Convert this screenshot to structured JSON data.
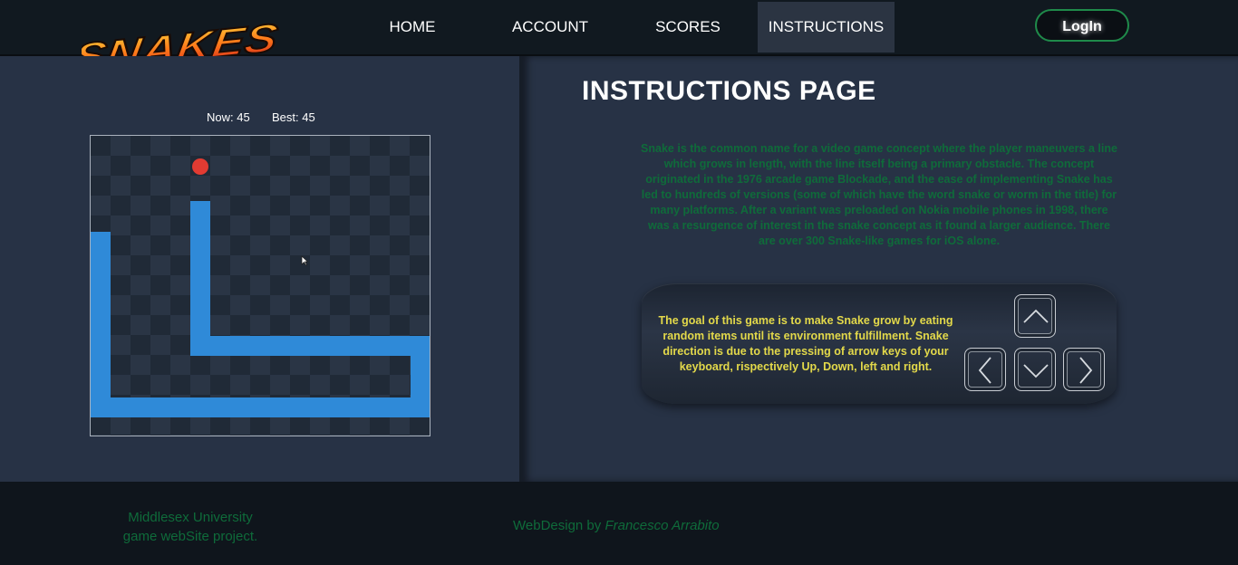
{
  "header": {
    "logo_text": "SNAKES",
    "nav": [
      "HOME",
      "ACCOUNT",
      "SCORES",
      "INSTRUCTIONS"
    ],
    "active_nav": "INSTRUCTIONS",
    "login_label": "LogIn"
  },
  "game": {
    "now_label": "Now: 45",
    "best_label": "Best: 45",
    "colors": {
      "snake": "#2f8ad8",
      "food": "#e23b32"
    }
  },
  "instructions": {
    "title": "INSTRUCTIONS PAGE",
    "intro": "Snake is the common name for a video game concept where the player maneuvers a line which grows in length, with the line itself being a primary obstacle. The concept originated in the 1976 arcade game Blockade, and the ease of implementing Snake has led to hundreds of versions (some of which have the word snake or worm in the title) for many platforms. After a variant was preloaded on Nokia mobile phones in 1998, there was a resurgence of interest in the snake concept as it found a larger audience. There are over 300 Snake-like games for iOS alone.",
    "goal": "The goal of this game is to make Snake grow by eating random items until its environment fulfillment. Snake direction is due to the pressing of arrow keys of your keyboard, rispectively Up, Down, left and right.",
    "keys": [
      "arrow-up-key",
      "arrow-left-key",
      "arrow-down-key",
      "arrow-right-key"
    ]
  },
  "footer": {
    "left_line1": "Middlesex University",
    "left_line2": "game webSite project.",
    "credit_prefix": "WebDesign by ",
    "credit_name": "Francesco Arrabito"
  }
}
